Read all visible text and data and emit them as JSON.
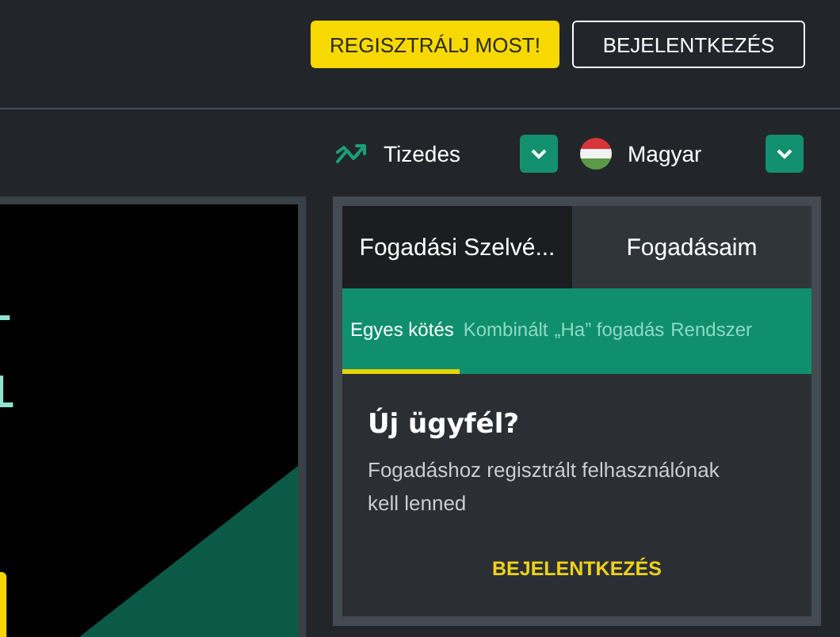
{
  "header": {
    "buttons": [
      {
        "label": "REGISZTRÁLJ MOST!",
        "kind": "primary"
      },
      {
        "label": "BEJELENTKEZÉS",
        "kind": "outline"
      }
    ]
  },
  "selectors": [
    {
      "kind": "odds",
      "label": "Tizedes"
    },
    {
      "kind": "language",
      "label": "Magyar"
    }
  ],
  "betslip": {
    "tabs": [
      {
        "label": "Fogadási Szelvé...",
        "selected": true
      },
      {
        "label": "Fogadásaim",
        "selected": false
      }
    ],
    "bet_types": [
      {
        "label": "Egyes kötés",
        "selected": true
      },
      {
        "label": "Kombinált",
        "selected": false
      },
      {
        "label": "„Ha” fogadás",
        "selected": false
      },
      {
        "label": "Rendszer",
        "selected": false
      }
    ],
    "heading": "Új ügyfél?",
    "message": "Fogadáshoz regisztrált felhasználónak kell lenned",
    "login_link": "BEJELENTKEZÉS"
  }
}
